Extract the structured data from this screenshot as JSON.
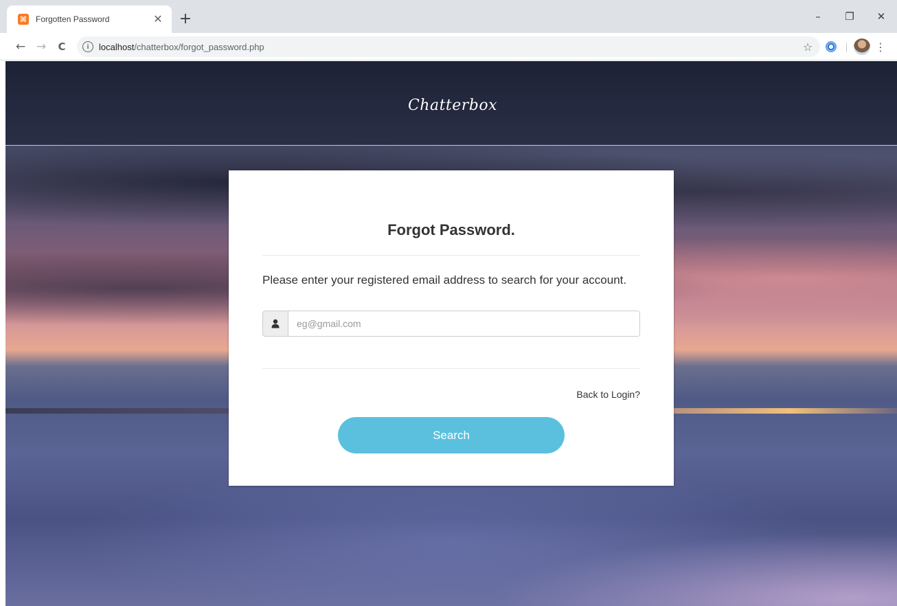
{
  "browser": {
    "tab": {
      "title": "Forgotten Password",
      "favicon_glyph": "⌘",
      "close_glyph": "✕"
    },
    "new_tab_glyph": "+",
    "window_controls": {
      "minimize": "–",
      "restore": "❐",
      "close": "✕"
    },
    "nav": {
      "back": "←",
      "forward": "→",
      "reload": "C"
    },
    "address_bar": {
      "host": "localhost",
      "path": "/chatterbox/forgot_password.php",
      "info_glyph": "i"
    },
    "bookmark_glyph": "☆",
    "menu_glyph": "⋮"
  },
  "page": {
    "brand": "Chatterbox",
    "card": {
      "title": "Forgot Password.",
      "instructions": "Please enter your registered email address to search for your account.",
      "email": {
        "placeholder": "eg@gmail.com",
        "value": ""
      },
      "back_link": "Back to Login?",
      "search_button": "Search"
    }
  },
  "icons": {
    "user": "user-icon",
    "info": "info-icon",
    "star": "star-icon"
  },
  "colors": {
    "button": "#5bc0de",
    "card_bg": "#ffffff",
    "text": "#333333",
    "favicon": "#fb7a24"
  }
}
